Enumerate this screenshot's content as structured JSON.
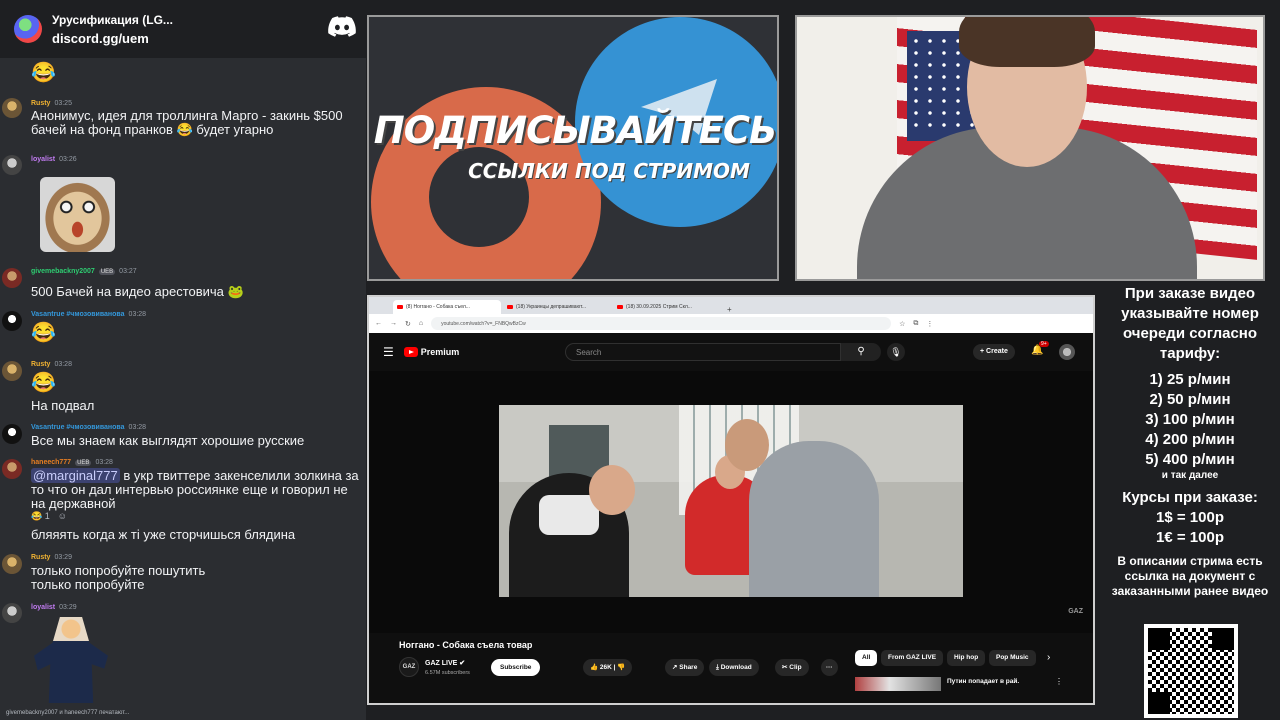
{
  "chat": {
    "server_name": "Урусификация (LG...",
    "server_link": "discord.gg/uem",
    "messages": [
      {
        "user": "Rusty",
        "time": "03:25",
        "text": "Анонимус, идея для троллинга Марго - закинь $500 бачей на фонд пранков",
        "text_end": "будет угарно"
      },
      {
        "user": "loyalist",
        "time": "03:26"
      },
      {
        "user": "givemebackny2007",
        "tag": "UEB",
        "time": "03:27",
        "text": "500 Бачей на видео арестовича"
      },
      {
        "user": "Vasantrue #чмозовиванова",
        "time": "03:28"
      },
      {
        "user": "Rusty",
        "time": "03:28",
        "text": "На подвал"
      },
      {
        "user": "Vasantrue #чмозовиванова",
        "time": "03:28",
        "text": "Все мы знаем как выглядят хорошие русские"
      },
      {
        "user": "haneech777",
        "tag": "UEB",
        "time": "03:28",
        "mention": "@marginal777",
        "text": "в укр твиттере закенселили золкина за то что он дал интервью россиянке еще и говорил не на державной",
        "reaction_count": "1",
        "text2": "бляяять когда ж ті уже сторчишься блядина"
      },
      {
        "user": "Rusty",
        "time": "03:29",
        "text": "только попробуйте пошутить",
        "text2": "только попробуйте"
      },
      {
        "user": "loyalist",
        "time": "03:29"
      }
    ],
    "typing": "givemebackny2007 и haneech777 печатают..."
  },
  "banner": {
    "title": "ПОДПИСЫВАЙТЕСЬ",
    "subtitle": "ССЫЛКИ ПОД СТРИМОМ"
  },
  "browser": {
    "tabs": [
      "(8) Ноггано - Собака съел...",
      "(18) Украинцы депрашивают...",
      "(18) 30.09.2025 Стрим Скл..."
    ],
    "url": "youtube.com/watch?v=_FNBQwBzCw",
    "search_placeholder": "Search",
    "logo_text": "Premium",
    "create_label": "Create",
    "notif_badge": "9+",
    "video_title": "Ноггано - Собака съела товар",
    "channel_name": "GAZ LIVE",
    "channel_subs": "6.57M subscribers",
    "subscribe_label": "Subscribe",
    "likes": "26K",
    "share_label": "Share",
    "download_label": "Download",
    "clip_label": "Clip",
    "chips": [
      "All",
      "From GAZ LIVE",
      "Hip hop",
      "Pop Music"
    ],
    "rec_title": "Путин попадает в рай.",
    "watermark": "GAZ",
    "channel_avatar_text": "GAZ"
  },
  "info": {
    "intro": "При заказе видео указывайте номер очереди согласно тарифу:",
    "tariffs": [
      "1) 25 р/мин",
      "2) 50 р/мин",
      "3) 100 р/мин",
      "4) 200 р/мин",
      "5) 400 р/мин"
    ],
    "etc": "и так далее",
    "rates_title": "Курсы при заказе:",
    "rates": [
      "1$ = 100р",
      "1€ = 100р"
    ],
    "note": "В описании стрима есть ссылка на документ с заказанными ранее видео"
  },
  "colors": {
    "discord_bg": "#2b2d31",
    "accent_red": "#ff0000",
    "telegram_blue": "#3592d3",
    "boosty_orange": "#d86a4a"
  }
}
